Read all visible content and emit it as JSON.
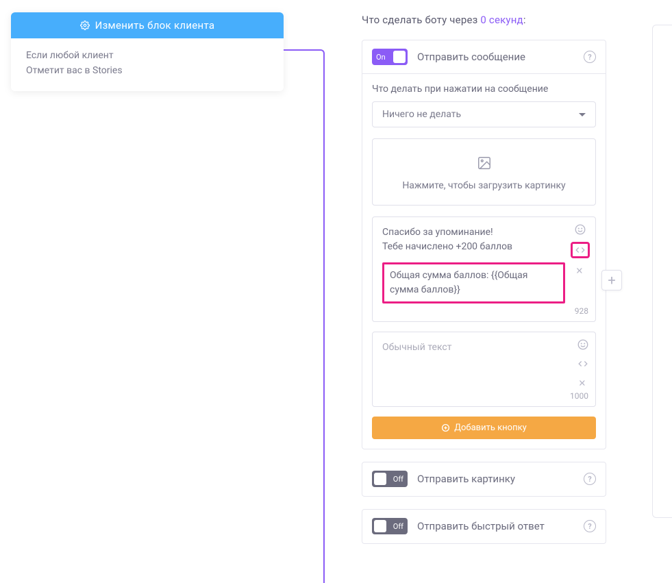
{
  "client_block": {
    "header": "Изменить блок клиента",
    "line1": "Если любой клиент",
    "line2": "Отметит вас в Stories"
  },
  "panel": {
    "title_prefix": "Что сделать боту через ",
    "delay_text": "0 секунд",
    "title_suffix": ":"
  },
  "send_message": {
    "toggle": "On",
    "title": "Отправить сообщение",
    "on_tap_label": "Что делать при нажатии на сообщение",
    "on_tap_value": "Ничего не делать",
    "upload_hint": "Нажмите, чтобы загрузить картинку",
    "msg1_line1": "Спасибо за упоминание!",
    "msg1_line2": "Тебе начислено +200 баллов",
    "msg1_var": "Общая сумма баллов:  {{Общая сумма баллов}}",
    "msg1_count": "928",
    "msg2_placeholder": "Обычный текст",
    "msg2_count": "1000",
    "add_button": "Добавить кнопку"
  },
  "send_image": {
    "toggle": "Off",
    "title": "Отправить картинку"
  },
  "quick_reply": {
    "toggle": "Off",
    "title": "Отправить быстрый ответ"
  }
}
